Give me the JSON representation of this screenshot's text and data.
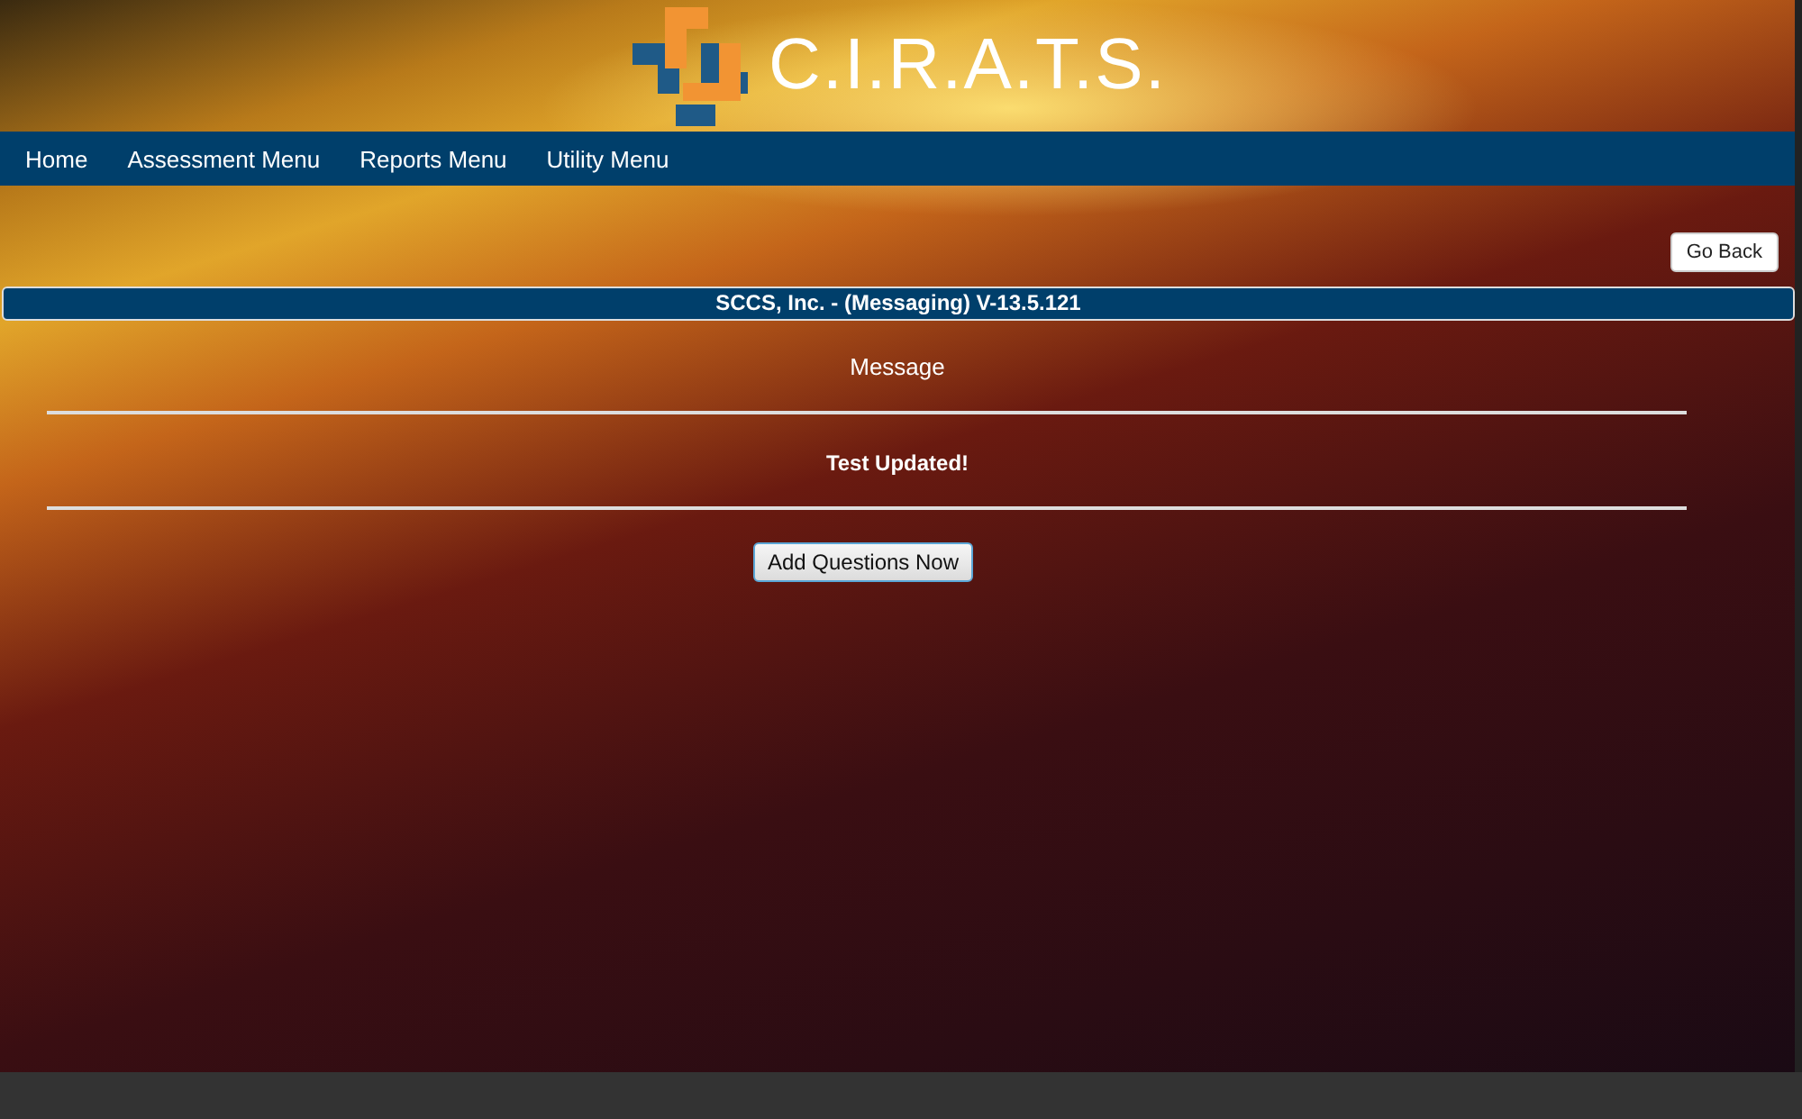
{
  "header": {
    "logo_text": "C.I.R.A.T.S."
  },
  "nav": {
    "items": [
      {
        "label": "Home"
      },
      {
        "label": "Assessment Menu"
      },
      {
        "label": "Reports Menu"
      },
      {
        "label": "Utility Menu"
      }
    ]
  },
  "go_back_button": "Go Back",
  "title_bar": "SCCS, Inc. - (Messaging) V-13.5.121",
  "message_heading": "Message",
  "message": "Test Updated!",
  "action_button": "Add Questions Now"
}
